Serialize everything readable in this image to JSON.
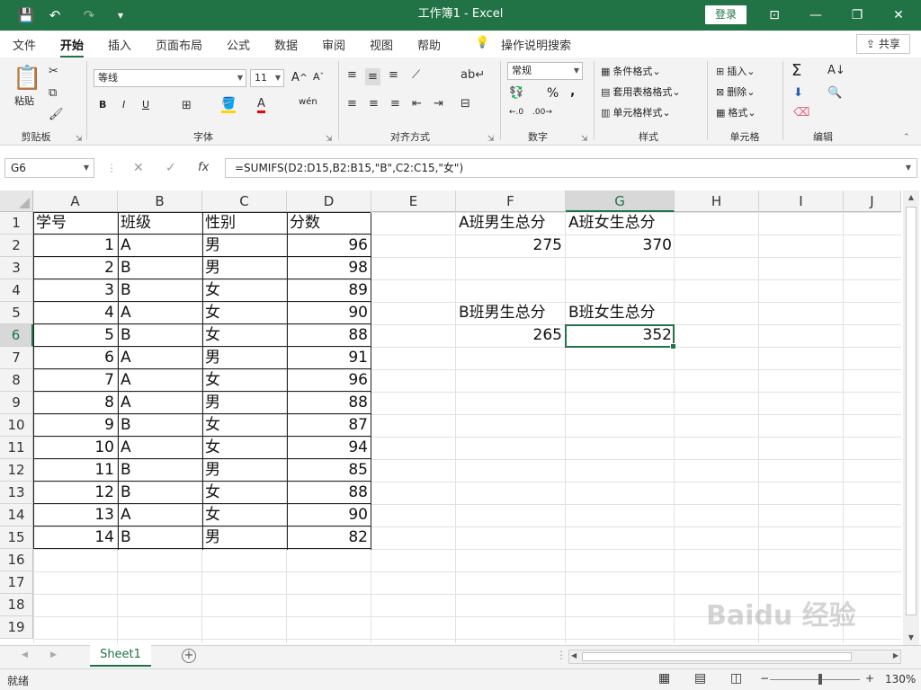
{
  "window": {
    "title": "工作簿1  -  Excel",
    "login_label": "登录",
    "buttons": {
      "ribbon_display": "⊡",
      "minimize": "—",
      "restore": "❐",
      "close": "✕"
    }
  },
  "quick_access": {
    "save": "💾",
    "undo": "↶",
    "redo": "↷",
    "customize": "▾"
  },
  "menu": {
    "tabs": [
      "文件",
      "开始",
      "插入",
      "页面布局",
      "公式",
      "数据",
      "审阅",
      "视图",
      "帮助"
    ],
    "active_tab": "开始",
    "tell_me": "操作说明搜索",
    "share": "共享"
  },
  "ribbon": {
    "clipboard": {
      "paste": "粘贴",
      "label": "剪贴板"
    },
    "font": {
      "name": "等线",
      "size": "11",
      "bold": "B",
      "italic": "I",
      "underline": "U",
      "label": "字体"
    },
    "alignment": {
      "label": "对齐方式"
    },
    "number": {
      "format": "常规",
      "percent": "%",
      "comma": ",",
      "label": "数字"
    },
    "styles": {
      "conditional": "条件格式",
      "table": "套用表格格式",
      "cell": "单元格样式",
      "label": "样式"
    },
    "cells": {
      "insert": "插入",
      "delete": "删除",
      "format": "格式",
      "label": "单元格"
    },
    "editing": {
      "label": "编辑"
    }
  },
  "formula_bar": {
    "name_box": "G6",
    "fx": "fx",
    "cancel": "✕",
    "enter": "✓",
    "formula": "=SUMIFS(D2:D15,B2:B15,\"B\",C2:C15,\"女\")"
  },
  "sheet": {
    "columns": [
      "A",
      "B",
      "C",
      "D",
      "E",
      "F",
      "G",
      "H",
      "I",
      "J"
    ],
    "rows": [
      "1",
      "2",
      "3",
      "4",
      "5",
      "6",
      "7",
      "8",
      "9",
      "10",
      "11",
      "12",
      "13",
      "14",
      "15",
      "16",
      "17",
      "18",
      "19"
    ],
    "selected_column": "G",
    "selected_row": "6",
    "table": {
      "headers": [
        "学号",
        "班级",
        "性别",
        "分数"
      ],
      "rows": [
        [
          "1",
          "A",
          "男",
          "96"
        ],
        [
          "2",
          "B",
          "男",
          "98"
        ],
        [
          "3",
          "B",
          "女",
          "89"
        ],
        [
          "4",
          "A",
          "女",
          "90"
        ],
        [
          "5",
          "B",
          "女",
          "88"
        ],
        [
          "6",
          "A",
          "男",
          "91"
        ],
        [
          "7",
          "A",
          "女",
          "96"
        ],
        [
          "8",
          "A",
          "男",
          "88"
        ],
        [
          "9",
          "B",
          "女",
          "87"
        ],
        [
          "10",
          "A",
          "女",
          "94"
        ],
        [
          "11",
          "B",
          "男",
          "85"
        ],
        [
          "12",
          "B",
          "女",
          "88"
        ],
        [
          "13",
          "A",
          "女",
          "90"
        ],
        [
          "14",
          "B",
          "男",
          "82"
        ]
      ]
    },
    "summary": {
      "f1": "A班男生总分",
      "g1": "A班女生总分",
      "f2": "275",
      "g2": "370",
      "f5": "B班男生总分",
      "g5": "B班女生总分",
      "f6": "265",
      "g6": "352"
    }
  },
  "sheet_tabs": {
    "active": "Sheet1",
    "add": "+"
  },
  "status": {
    "ready": "就绪",
    "zoom": "130%",
    "zoom_minus": "−",
    "zoom_plus": "+"
  },
  "watermark": "Baidu 经验"
}
